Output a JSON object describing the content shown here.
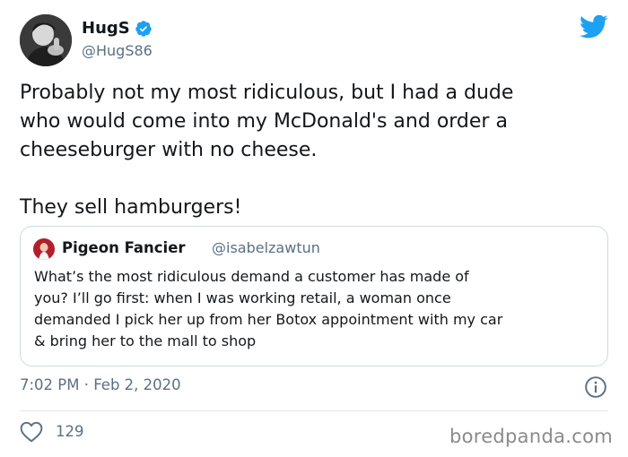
{
  "tweet": {
    "author": {
      "display_name": "HugS",
      "handle": "@HugS86",
      "verified": true
    },
    "body_lines": [
      "Probably not my most ridiculous, but I had a dude",
      "who would come into my McDonald's and order a",
      "cheeseburger with no cheese.",
      "They sell hamburgers!"
    ],
    "timestamp": "7:02 PM · Feb 2, 2020",
    "like_count": "129"
  },
  "quoted_tweet": {
    "author": {
      "display_name": "Pigeon Fancier",
      "handle": "@isabelzawtun"
    },
    "body_lines": [
      "What’s the most ridiculous demand a customer has made of",
      "you? I’ll go first: when I was working retail, a woman once",
      "demanded I pick her up from her Botox appointment with my car",
      "& bring her to the mall to shop"
    ]
  },
  "watermark": "boredpanda.com",
  "colors": {
    "twitter_blue": "#1da1f2",
    "text_primary": "#14171a",
    "text_secondary": "#5b7083",
    "border": "#cfd9de"
  },
  "icons": [
    "verified-badge-icon",
    "twitter-bird-icon",
    "info-icon",
    "heart-icon"
  ]
}
